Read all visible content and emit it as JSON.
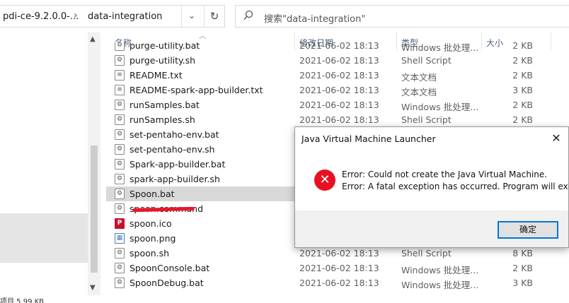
{
  "address": {
    "segment1": "pdi-ce-9.2.0.0-...",
    "segment2": "data-integration",
    "dropdown_glyph": "⌄",
    "refresh_glyph": "↻"
  },
  "search": {
    "placeholder": "搜索\"data-integration\""
  },
  "columns": {
    "name": "名称",
    "date": "修改日期",
    "type": "类型",
    "size": "大小"
  },
  "files": [
    {
      "name": "purge-utility.bat",
      "date": "2021-06-02 18:13",
      "type": "Windows 批处理...",
      "size": "2 KB",
      "icon": "bat-file-icon"
    },
    {
      "name": "purge-utility.sh",
      "date": "2021-06-02 18:13",
      "type": "Shell Script",
      "size": "2 KB",
      "icon": "sh-file-icon"
    },
    {
      "name": "README.txt",
      "date": "2021-06-02 18:13",
      "type": "文本文档",
      "size": "2 KB",
      "icon": "txt-file-icon"
    },
    {
      "name": "README-spark-app-builder.txt",
      "date": "2021-06-02 18:13",
      "type": "文本文档",
      "size": "3 KB",
      "icon": "txt-file-icon"
    },
    {
      "name": "runSamples.bat",
      "date": "2021-06-02 18:13",
      "type": "Windows 批处理...",
      "size": "2 KB",
      "icon": "bat-file-icon"
    },
    {
      "name": "runSamples.sh",
      "date": "2021-06-02 18:13",
      "type": "Shell Script",
      "size": "2 KB",
      "icon": "sh-file-icon"
    },
    {
      "name": "set-pentaho-env.bat",
      "date": "",
      "type": "",
      "size": "",
      "icon": "bat-file-icon"
    },
    {
      "name": "set-pentaho-env.sh",
      "date": "",
      "type": "",
      "size": "",
      "icon": "sh-file-icon"
    },
    {
      "name": "Spark-app-builder.bat",
      "date": "",
      "type": "",
      "size": "",
      "icon": "bat-file-icon"
    },
    {
      "name": "spark-app-builder.sh",
      "date": "",
      "type": "",
      "size": "",
      "icon": "sh-file-icon"
    },
    {
      "name": "Spoon.bat",
      "date": "",
      "type": "",
      "size": "",
      "icon": "bat-file-icon"
    },
    {
      "name": "spoon.command",
      "date": "",
      "type": "",
      "size": "",
      "icon": "command-file-icon"
    },
    {
      "name": "spoon.ico",
      "date": "",
      "type": "",
      "size": "",
      "icon": "ico-file-icon"
    },
    {
      "name": "spoon.png",
      "date": "",
      "type": "",
      "size": "",
      "icon": "png-file-icon"
    },
    {
      "name": "spoon.sh",
      "date": "2021-06-02 18:13",
      "type": "Shell Script",
      "size": "8 KB",
      "icon": "sh-file-icon"
    },
    {
      "name": "SpoonConsole.bat",
      "date": "2021-06-02 18:13",
      "type": "Windows 批处理...",
      "size": "2 KB",
      "icon": "bat-file-icon"
    },
    {
      "name": "SpoonDebug.bat",
      "date": "2021-06-02 18:13",
      "type": "Windows 批处理...",
      "size": "3 KB",
      "icon": "bat-file-icon"
    }
  ],
  "status": {
    "text": "项目 5.99 KB"
  },
  "dialog": {
    "title": "Java Virtual Machine Launcher",
    "close_glyph": "✕",
    "line1": "Error: Could not create the Java Virtual Machine.",
    "line2": "Error: A fatal exception has occurred. Program will exit.",
    "ok_label": "确定",
    "error_glyph": "✕"
  },
  "colors": {
    "annotation": "#e8172c",
    "error_icon": "#e81123",
    "ok_focus": "#0078d7"
  }
}
